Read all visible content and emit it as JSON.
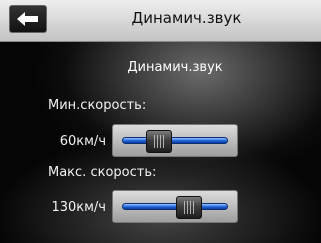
{
  "header": {
    "back_icon": "left-arrow-icon",
    "title": "Динамич.звук"
  },
  "main": {
    "section_title": "Динамич.звук",
    "min_speed": {
      "label": "Мин.скорость:",
      "value": "60км/ч",
      "slider_fraction": 0.3
    },
    "max_speed": {
      "label": "Макс. скорость:",
      "value": "130км/ч",
      "slider_fraction": 0.68
    }
  }
}
